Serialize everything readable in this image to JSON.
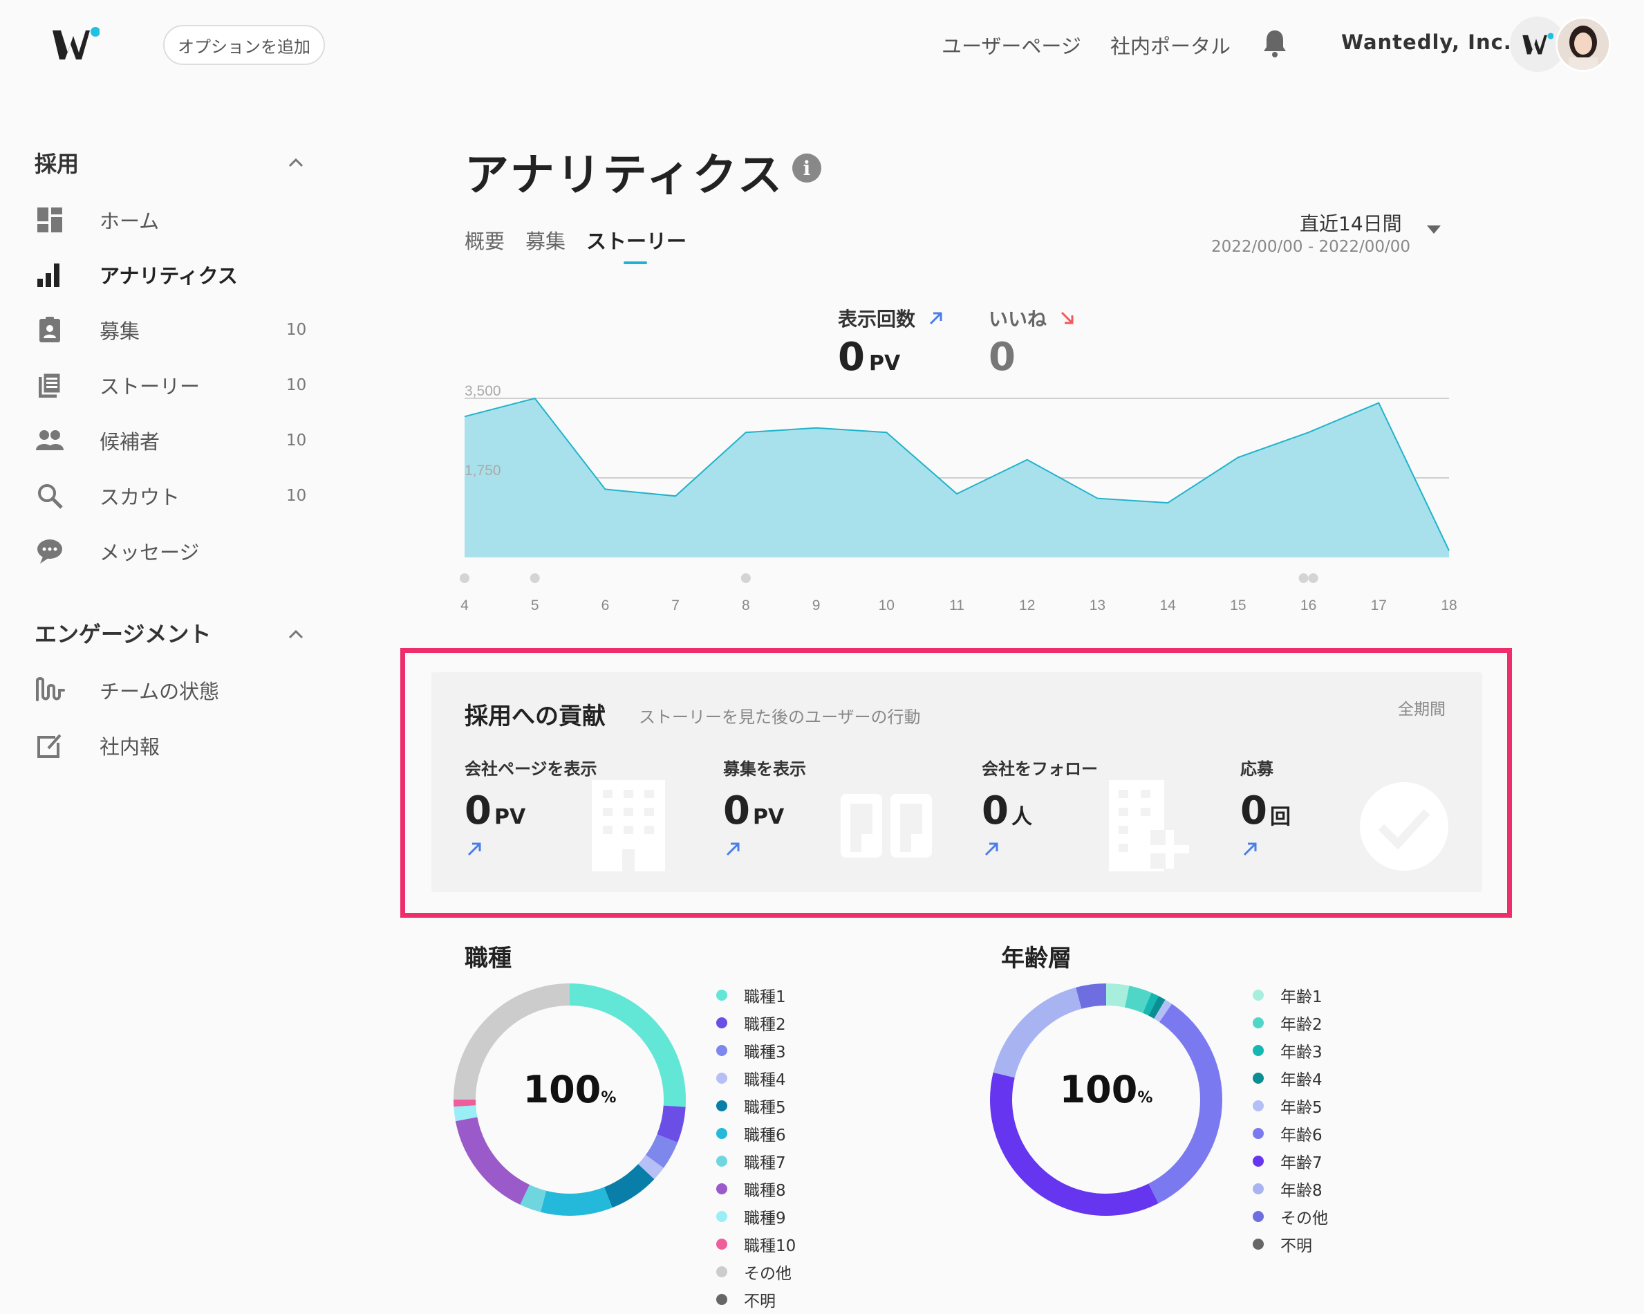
{
  "header": {
    "add_option": "オプションを追加",
    "nav": [
      "ユーザーページ",
      "社内ポータル"
    ],
    "company": "Wantedly, Inc."
  },
  "sidebar": {
    "sections": [
      {
        "title": "採用",
        "items": [
          {
            "label": "ホーム",
            "count": "",
            "icon": "dashboard-icon"
          },
          {
            "label": "アナリティクス",
            "count": "",
            "icon": "bar-chart-icon"
          },
          {
            "label": "募集",
            "count": "10",
            "icon": "badge-icon"
          },
          {
            "label": "ストーリー",
            "count": "10",
            "icon": "document-icon"
          },
          {
            "label": "候補者",
            "count": "10",
            "icon": "people-icon"
          },
          {
            "label": "スカウト",
            "count": "10",
            "icon": "search-icon"
          },
          {
            "label": "メッセージ",
            "count": "",
            "icon": "chat-icon"
          }
        ]
      },
      {
        "title": "エンゲージメント",
        "items": [
          {
            "label": "チームの状態",
            "count": "",
            "icon": "wave-icon"
          },
          {
            "label": "社内報",
            "count": "",
            "icon": "edit-icon"
          }
        ]
      }
    ]
  },
  "page": {
    "title": "アナリティクス",
    "tabs": [
      "概要",
      "募集",
      "ストーリー"
    ],
    "active_tab": "ストーリー",
    "period": "直近14日間",
    "period_range": "2022/00/00 - 2022/00/00"
  },
  "metrics": {
    "views": {
      "label": "表示回数",
      "value": "0",
      "unit": "PV",
      "trend": "up"
    },
    "likes": {
      "label": "いいね",
      "value": "0",
      "trend": "down"
    }
  },
  "chart_data": {
    "type": "area",
    "x": [
      "4",
      "5",
      "6",
      "7",
      "8",
      "9",
      "10",
      "11",
      "12",
      "13",
      "14",
      "15",
      "16",
      "17",
      "18"
    ],
    "values": [
      3100,
      3500,
      1500,
      1350,
      2750,
      2850,
      2750,
      1400,
      2150,
      1300,
      1200,
      2200,
      2750,
      3400,
      150
    ],
    "y_ticks": [
      "3,500",
      "1,750"
    ],
    "ylim": [
      0,
      3500
    ],
    "event_markers": [
      {
        "x": "4",
        "count": 1
      },
      {
        "x": "5",
        "count": 1
      },
      {
        "x": "8",
        "count": 1
      },
      {
        "x": "16",
        "count": 2
      }
    ],
    "colors": {
      "fill": "#a8e1eb",
      "line": "#20b3cb",
      "grid": "#cfcfcf",
      "marker": "#d4d4d4"
    }
  },
  "contribution": {
    "title": "採用への貢献",
    "subtitle": "ストーリーを見た後のユーザーの行動",
    "period": "全期間",
    "items": [
      {
        "label": "会社ページを表示",
        "value": "0",
        "unit": "PV",
        "icon": "building-icon"
      },
      {
        "label": "募集を表示",
        "value": "0",
        "unit": "PV",
        "icon": "door-icon"
      },
      {
        "label": "会社をフォロー",
        "value": "0",
        "unit": "人",
        "icon": "building-plus-icon"
      },
      {
        "label": "応募",
        "value": "0",
        "unit": "回",
        "icon": "check-circle-icon"
      }
    ]
  },
  "occupation": {
    "title": "職種",
    "center": "100",
    "center_unit": "%",
    "legend": [
      {
        "label": "職種1",
        "color": "#62e6d6"
      },
      {
        "label": "職種2",
        "color": "#6a4ee6"
      },
      {
        "label": "職種3",
        "color": "#7d87ec"
      },
      {
        "label": "職種4",
        "color": "#b6bff6"
      },
      {
        "label": "職種5",
        "color": "#087ea8"
      },
      {
        "label": "職種6",
        "color": "#24b9da"
      },
      {
        "label": "職種7",
        "color": "#6fd6e0"
      },
      {
        "label": "職種8",
        "color": "#9a5ac9"
      },
      {
        "label": "職種9",
        "color": "#9aeef6"
      },
      {
        "label": "職種10",
        "color": "#ef5d9a"
      },
      {
        "label": "その他",
        "color": "#cccccc"
      },
      {
        "label": "不明",
        "color": "#666666"
      }
    ],
    "values": [
      26,
      5,
      4,
      2,
      7,
      10,
      3,
      15,
      2,
      1,
      25,
      0
    ]
  },
  "age": {
    "title": "年齢層",
    "center": "100",
    "center_unit": "%",
    "legend": [
      {
        "label": "年齢1",
        "color": "#a8eedd"
      },
      {
        "label": "年齢2",
        "color": "#4fd6c6"
      },
      {
        "label": "年齢3",
        "color": "#16b6b3"
      },
      {
        "label": "年齢4",
        "color": "#0b8e91"
      },
      {
        "label": "年齢5",
        "color": "#b4bff6"
      },
      {
        "label": "年齢6",
        "color": "#7b79ef"
      },
      {
        "label": "年齢7",
        "color": "#6535f0"
      },
      {
        "label": "年齢8",
        "color": "#a8b4f2"
      },
      {
        "label": "その他",
        "color": "#6f6ee0"
      },
      {
        "label": "不明",
        "color": "#666666"
      }
    ],
    "values": [
      3,
      3,
      1,
      1,
      1,
      31,
      34,
      16,
      4,
      0
    ]
  }
}
